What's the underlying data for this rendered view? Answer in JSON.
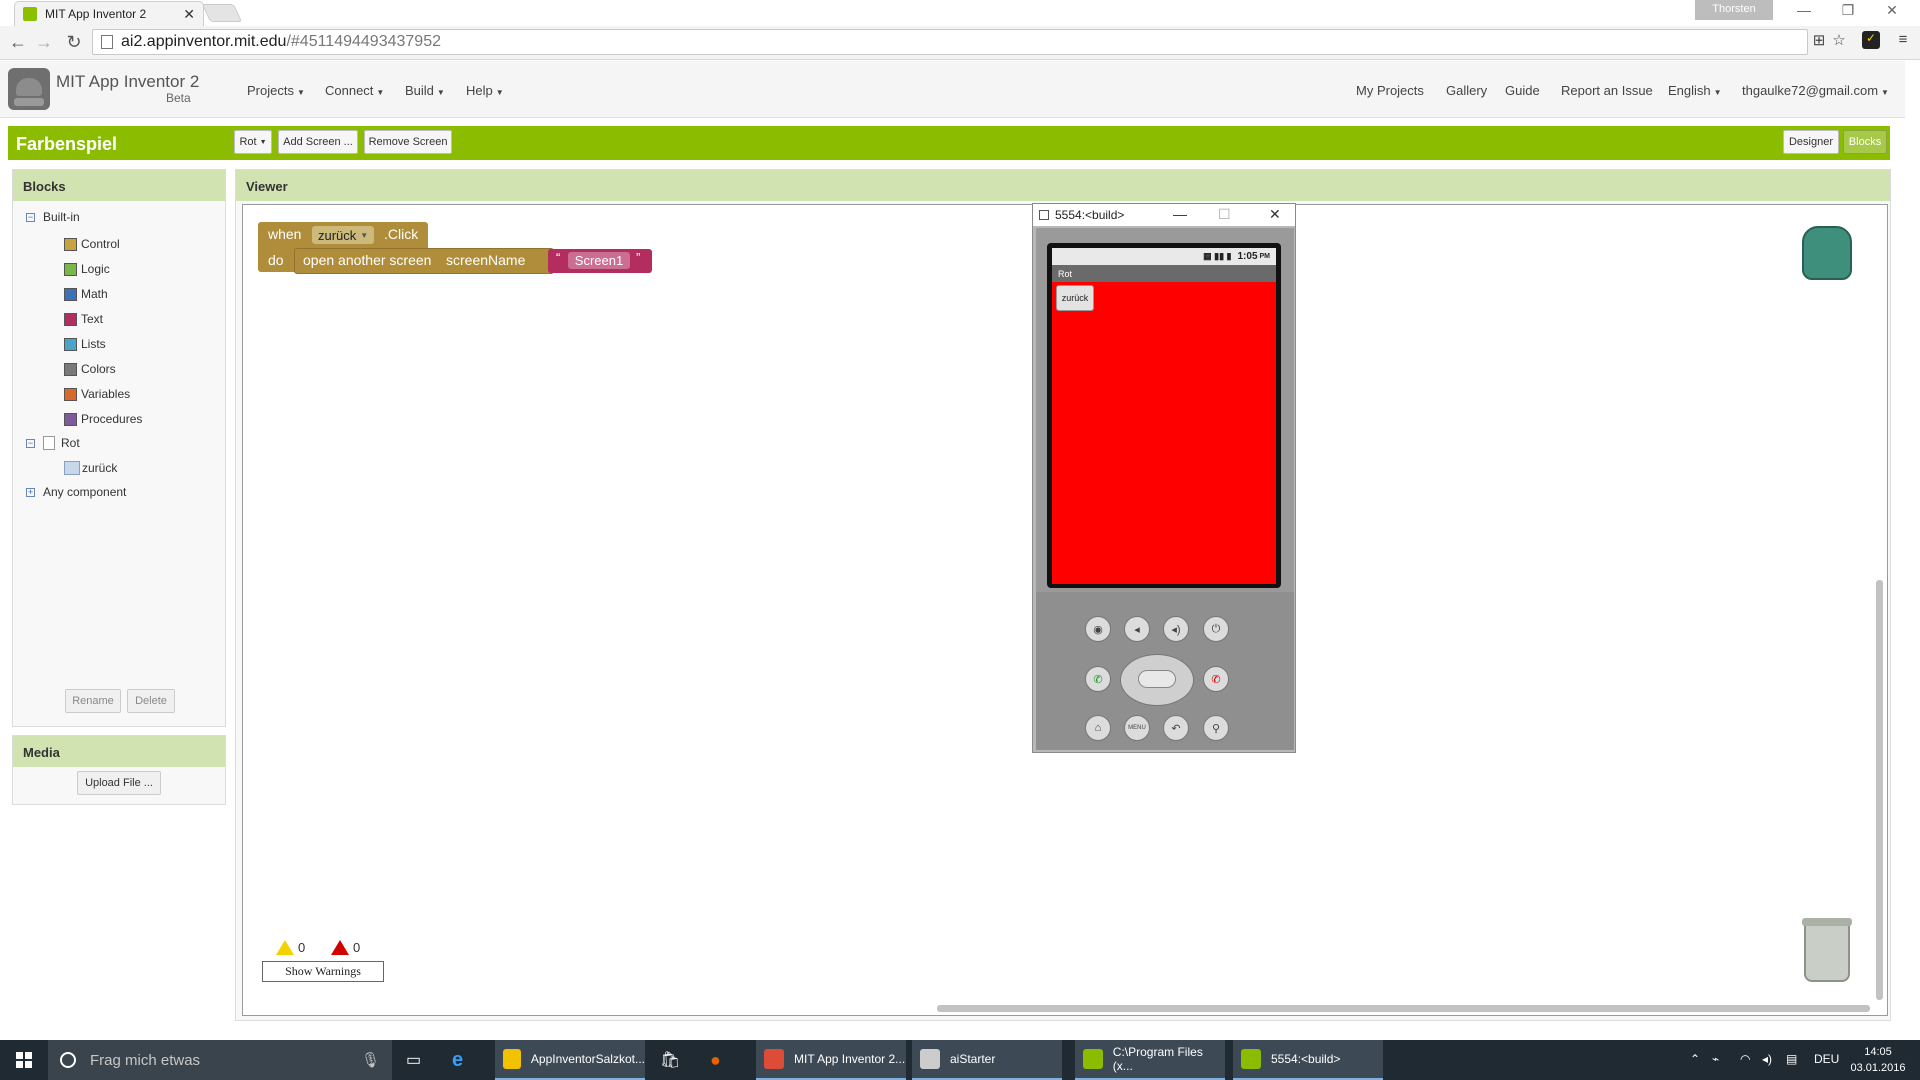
{
  "browser": {
    "tab_title": "MIT App Inventor 2",
    "profile_name": "Thorsten",
    "url_host": "ai2.appinventor.mit.edu",
    "url_path": "/#4511494493437952"
  },
  "app": {
    "title": "MIT App Inventor 2",
    "subtitle": "Beta",
    "menus": [
      "Projects",
      "Connect",
      "Build",
      "Help"
    ],
    "right_links": [
      "My Projects",
      "Gallery",
      "Guide",
      "Report an Issue"
    ],
    "language": "English",
    "account": "thgaulke72@gmail.com"
  },
  "project": {
    "name": "Farbenspiel",
    "screen_selector": "Rot",
    "add_screen": "Add Screen ...",
    "remove_screen": "Remove Screen",
    "designer": "Designer",
    "blocks": "Blocks"
  },
  "blocks_panel": {
    "header": "Blocks",
    "builtin_label": "Built-in",
    "builtin_items": [
      {
        "label": "Control",
        "color": "#c8a23c"
      },
      {
        "label": "Logic",
        "color": "#7ab648"
      },
      {
        "label": "Math",
        "color": "#3f72b5"
      },
      {
        "label": "Text",
        "color": "#b32d5e"
      },
      {
        "label": "Lists",
        "color": "#4aa3c9"
      },
      {
        "label": "Colors",
        "color": "#7a7a7a"
      },
      {
        "label": "Variables",
        "color": "#d8692c"
      },
      {
        "label": "Procedures",
        "color": "#7e5a9b"
      }
    ],
    "screen_label": "Rot",
    "component_label": "zurück",
    "any_component": "Any component",
    "rename": "Rename",
    "delete": "Delete"
  },
  "media_panel": {
    "header": "Media",
    "upload": "Upload File ..."
  },
  "viewer": {
    "header": "Viewer",
    "block_when": "when",
    "block_component": "zurück",
    "block_event": ".Click",
    "block_do": "do",
    "block_open": "open another screen",
    "block_param": "screenName",
    "block_quote_open": "“",
    "block_string": "Screen1",
    "block_quote_close": "”",
    "warnings_count": "0",
    "errors_count": "0",
    "show_warnings": "Show Warnings"
  },
  "emulator": {
    "window_title": "5554:<build>",
    "status_time": "1:05",
    "status_ampm": "PM",
    "app_title": "Rot",
    "button_label": "zurück",
    "screen_color": "#ff0000",
    "menu_label": "MENU"
  },
  "taskbar": {
    "search_placeholder": "Frag mich etwas",
    "items": [
      {
        "label": "AppInventorSalzkot...",
        "color": "#f2c200"
      },
      {
        "label": "MIT App Inventor 2...",
        "color": "#dd4b39"
      },
      {
        "label": "aiStarter",
        "color": "#cccccc"
      },
      {
        "label": "C:\\Program Files (x...",
        "color": "#8cbc00"
      },
      {
        "label": "5554:<build>",
        "color": "#8cbc00"
      }
    ],
    "language": "DEU",
    "time": "14:05",
    "date": "03.01.2016"
  }
}
